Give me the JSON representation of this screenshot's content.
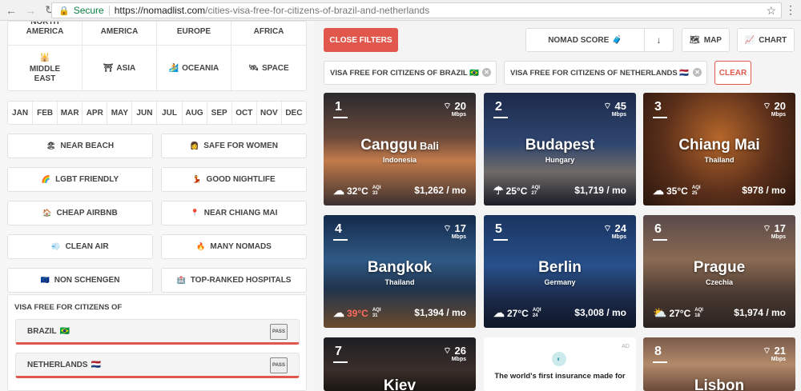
{
  "browser": {
    "secure_label": "Secure",
    "url_host": "https://nomadlist.com",
    "url_path": "/cities-visa-free-for-citizens-of-brazil-and-netherlands"
  },
  "sidebar": {
    "regions": [
      {
        "label": "NORTH AMERICA",
        "icon": ""
      },
      {
        "label": "AMERICA",
        "icon": ""
      },
      {
        "label": "EUROPE",
        "icon": ""
      },
      {
        "label": "AFRICA",
        "icon": ""
      },
      {
        "label": "MIDDLE EAST",
        "icon": "mosque-icon"
      },
      {
        "label": "ASIA",
        "icon": "torii-icon"
      },
      {
        "label": "OCEANIA",
        "icon": "surfer-icon"
      },
      {
        "label": "SPACE",
        "icon": "satellite-icon"
      }
    ],
    "months": [
      "JAN",
      "FEB",
      "MAR",
      "APR",
      "MAY",
      "JUN",
      "JUL",
      "AUG",
      "SEP",
      "OCT",
      "NOV",
      "DEC"
    ],
    "filters": [
      {
        "label": "NEAR BEACH",
        "icon": "beach-icon"
      },
      {
        "label": "SAFE FOR WOMEN",
        "icon": "woman-icon"
      },
      {
        "label": "LGBT FRIENDLY",
        "icon": "rainbow-icon"
      },
      {
        "label": "GOOD NIGHTLIFE",
        "icon": "dancer-icon"
      },
      {
        "label": "CHEAP AIRBNB",
        "icon": "house-icon"
      },
      {
        "label": "NEAR CHIANG MAI",
        "icon": "pin-icon"
      },
      {
        "label": "CLEAN AIR",
        "icon": "wind-icon"
      },
      {
        "label": "MANY NOMADS",
        "icon": "fire-icon"
      },
      {
        "label": "NON SCHENGEN",
        "icon": "eu-flag-icon"
      },
      {
        "label": "TOP-RANKED HOSPITALS",
        "icon": "hospital-icon"
      }
    ],
    "visa": {
      "title": "VISA FREE FOR CITIZENS OF",
      "countries": [
        {
          "label": "BRAZIL",
          "flag": "🇧🇷"
        },
        {
          "label": "NETHERLANDS",
          "flag": "🇳🇱"
        }
      ],
      "passport_text": "PASS"
    }
  },
  "toolbar": {
    "close_filters": "CLOSE FILTERS",
    "sort_label": "NOMAD SCORE",
    "sort_dir": "↓",
    "map_label": "MAP",
    "chart_label": "CHART"
  },
  "chips": [
    {
      "label": "VISA FREE FOR CITIZENS OF BRAZIL 🇧🇷"
    },
    {
      "label": "VISA FREE FOR CITIZENS OF NETHERLANDS 🇳🇱"
    }
  ],
  "clear_label": "CLEAR",
  "cities": [
    {
      "rank": "1",
      "city": "Canggu",
      "sub": "Bali",
      "country": "Indonesia",
      "wifi": "20",
      "wifi_unit": "Mbps",
      "temp": "32°C",
      "aqi": "33",
      "price": "$1,262 / mo",
      "hot": false,
      "weather": "cloud-icon",
      "bg": "linear-gradient(180deg,#2b2a2e 0%,#6b4a3c 40%,#c27a4a 60%,#3b3030 100%)"
    },
    {
      "rank": "2",
      "city": "Budapest",
      "sub": "",
      "country": "Hungary",
      "wifi": "45",
      "wifi_unit": "Mbps",
      "temp": "25°C",
      "aqi": "27",
      "price": "$1,719 / mo",
      "hot": false,
      "weather": "rain-icon",
      "bg": "linear-gradient(180deg,#1c2a4a 0%,#2f4670 45%,#6f6a68 70%,#1a1c26 100%)"
    },
    {
      "rank": "3",
      "city": "Chiang Mai",
      "sub": "",
      "country": "Thailand",
      "wifi": "20",
      "wifi_unit": "Mbps",
      "temp": "35°C",
      "aqi": "25",
      "price": "$978 / mo",
      "hot": false,
      "weather": "cloud-icon",
      "bg": "radial-gradient(circle at 50% 40%,#b5662a 0%,#5a2f1a 55%,#2a160d 100%)"
    },
    {
      "rank": "4",
      "city": "Bangkok",
      "sub": "",
      "country": "Thailand",
      "wifi": "17",
      "wifi_unit": "Mbps",
      "temp": "39°C",
      "aqi": "31",
      "price": "$1,394 / mo",
      "hot": true,
      "weather": "cloud-icon",
      "bg": "linear-gradient(180deg,#142a4a 0%,#2f5a86 40%,#20344e 65%,#6a4a2c 100%)"
    },
    {
      "rank": "5",
      "city": "Berlin",
      "sub": "",
      "country": "Germany",
      "wifi": "24",
      "wifi_unit": "Mbps",
      "temp": "27°C",
      "aqi": "24",
      "price": "$3,008 / mo",
      "hot": false,
      "weather": "cloud-icon",
      "bg": "linear-gradient(180deg,#1a3460 0%,#28508a 45%,#1a2948 75%,#0f1626 100%)"
    },
    {
      "rank": "6",
      "city": "Prague",
      "sub": "",
      "country": "Czechia",
      "wifi": "17",
      "wifi_unit": "Mbps",
      "temp": "27°C",
      "aqi": "18",
      "price": "$1,974 / mo",
      "hot": false,
      "weather": "sun-cloud-icon",
      "bg": "linear-gradient(180deg,#5a4a4a 0%,#8a6a52 40%,#4a3a32 70%,#2a2220 100%)"
    },
    {
      "rank": "7",
      "city": "Kiev",
      "sub": "",
      "country": "",
      "wifi": "26",
      "wifi_unit": "Mbps",
      "temp": "",
      "aqi": "",
      "price": "",
      "hot": false,
      "weather": "",
      "bg": "linear-gradient(180deg,#1e1e24 0%,#3a2e2a 60%,#1a1612 100%)"
    },
    {
      "rank": "8",
      "city": "Lisbon",
      "sub": "",
      "country": "",
      "wifi": "21",
      "wifi_unit": "Mbps",
      "temp": "",
      "aqi": "",
      "price": "",
      "hot": false,
      "weather": "",
      "bg": "linear-gradient(180deg,#7a5a4a 0%,#b28a6a 50%,#6a4a3a 100%)"
    }
  ],
  "ad": {
    "label": "AD",
    "text": "The world's first insurance made for"
  },
  "colors": {
    "accent": "#e2574c"
  }
}
